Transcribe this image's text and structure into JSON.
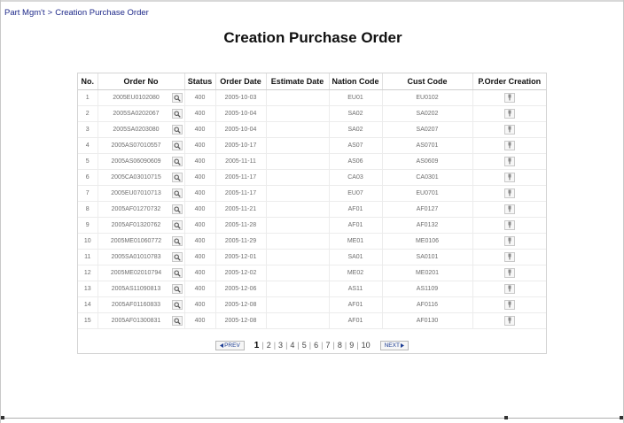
{
  "breadcrumb": {
    "parent": "Part Mgm't",
    "separator": ">",
    "current": "Creation Purchase Order"
  },
  "page_title": "Creation Purchase Order",
  "table": {
    "columns": [
      "No.",
      "Order No",
      "Status",
      "Order Date",
      "Estimate Date",
      "Nation Code",
      "Cust Code",
      "P.Order Creation"
    ],
    "rows": [
      {
        "no": "1",
        "order_no": "2005EU0102080",
        "status": "400",
        "order_date": "2005-10-03",
        "estimate_date": "",
        "nation_code": "EU01",
        "cust_code": "EU0102"
      },
      {
        "no": "2",
        "order_no": "2005SA0202067",
        "status": "400",
        "order_date": "2005-10-04",
        "estimate_date": "",
        "nation_code": "SA02",
        "cust_code": "SA0202"
      },
      {
        "no": "3",
        "order_no": "2005SA0203080",
        "status": "400",
        "order_date": "2005-10-04",
        "estimate_date": "",
        "nation_code": "SA02",
        "cust_code": "SA0207"
      },
      {
        "no": "4",
        "order_no": "2005AS07010557",
        "status": "400",
        "order_date": "2005-10-17",
        "estimate_date": "",
        "nation_code": "AS07",
        "cust_code": "AS0701"
      },
      {
        "no": "5",
        "order_no": "2005AS06090609",
        "status": "400",
        "order_date": "2005-11-11",
        "estimate_date": "",
        "nation_code": "AS06",
        "cust_code": "AS0609"
      },
      {
        "no": "6",
        "order_no": "2005CA03010715",
        "status": "400",
        "order_date": "2005-11-17",
        "estimate_date": "",
        "nation_code": "CA03",
        "cust_code": "CA0301"
      },
      {
        "no": "7",
        "order_no": "2005EU07010713",
        "status": "400",
        "order_date": "2005-11-17",
        "estimate_date": "",
        "nation_code": "EU07",
        "cust_code": "EU0701"
      },
      {
        "no": "8",
        "order_no": "2005AF01270732",
        "status": "400",
        "order_date": "2005-11-21",
        "estimate_date": "",
        "nation_code": "AF01",
        "cust_code": "AF0127"
      },
      {
        "no": "9",
        "order_no": "2005AF01320762",
        "status": "400",
        "order_date": "2005-11-28",
        "estimate_date": "",
        "nation_code": "AF01",
        "cust_code": "AF0132"
      },
      {
        "no": "10",
        "order_no": "2005ME01060772",
        "status": "400",
        "order_date": "2005-11-29",
        "estimate_date": "",
        "nation_code": "ME01",
        "cust_code": "ME0106"
      },
      {
        "no": "11",
        "order_no": "2005SA01010783",
        "status": "400",
        "order_date": "2005-12-01",
        "estimate_date": "",
        "nation_code": "SA01",
        "cust_code": "SA0101"
      },
      {
        "no": "12",
        "order_no": "2005ME02010794",
        "status": "400",
        "order_date": "2005-12-02",
        "estimate_date": "",
        "nation_code": "ME02",
        "cust_code": "ME0201"
      },
      {
        "no": "13",
        "order_no": "2005AS11090813",
        "status": "400",
        "order_date": "2005-12-06",
        "estimate_date": "",
        "nation_code": "AS11",
        "cust_code": "AS1109"
      },
      {
        "no": "14",
        "order_no": "2005AF01160833",
        "status": "400",
        "order_date": "2005-12-08",
        "estimate_date": "",
        "nation_code": "AF01",
        "cust_code": "AF0116"
      },
      {
        "no": "15",
        "order_no": "2005AF01300831",
        "status": "400",
        "order_date": "2005-12-08",
        "estimate_date": "",
        "nation_code": "AF01",
        "cust_code": "AF0130"
      }
    ]
  },
  "pager": {
    "prev_label": "PREV",
    "next_label": "NEXT",
    "current": "1",
    "pages": [
      "1",
      "2",
      "3",
      "4",
      "5",
      "6",
      "7",
      "8",
      "9",
      "10"
    ]
  },
  "icons": {
    "lookup": "magnifier-icon",
    "create": "create-order-icon",
    "prev": "triangle-left-icon",
    "next": "triangle-right-icon"
  },
  "colors": {
    "breadcrumb_link": "#1f2a8a",
    "pager_button_text": "#1e3e94"
  }
}
